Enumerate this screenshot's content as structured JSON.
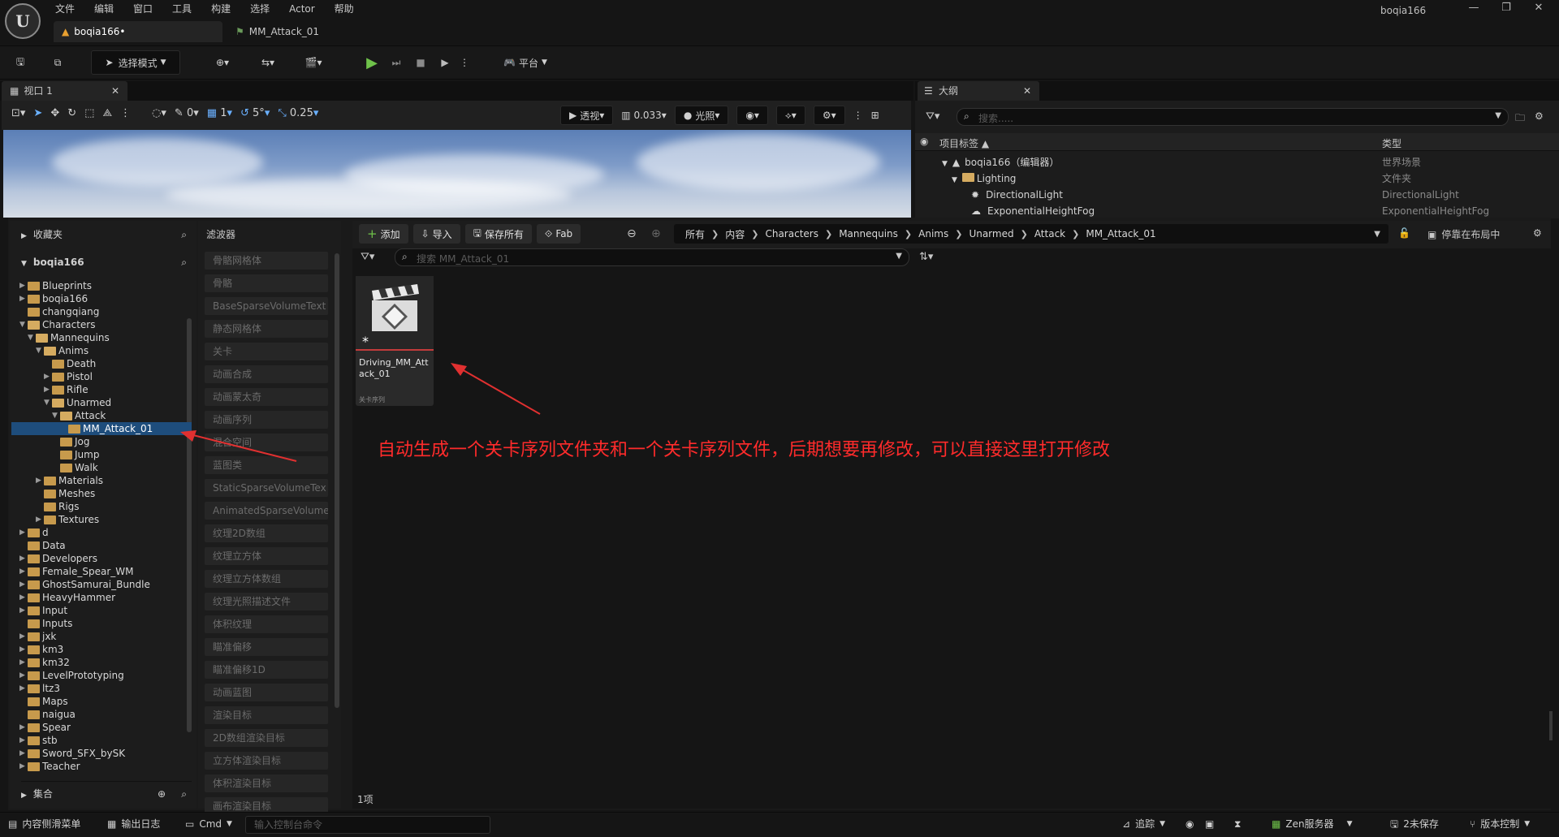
{
  "app": {
    "menu": [
      "文件",
      "编辑",
      "窗口",
      "工具",
      "构建",
      "选择",
      "Actor",
      "帮助"
    ],
    "project_name": "boqia166",
    "window_controls": [
      "—",
      "❐",
      "✕"
    ]
  },
  "doc_tabs": [
    {
      "label": "boqia166•",
      "active": true
    },
    {
      "label": "MM_Attack_01",
      "active": false
    }
  ],
  "toolbar": {
    "mode_label": "选择模式",
    "platform_label": "平台"
  },
  "viewport": {
    "tab_label": "视口 1",
    "view_mode": "透视",
    "lighting": "光照",
    "grid_values": [
      "0",
      "1",
      "5°",
      "0.25"
    ],
    "camera_speed": "0.033"
  },
  "outliner": {
    "tab_label": "大纲",
    "search_placeholder": "搜索.....",
    "col_label": "项目标签 ▲",
    "col_type": "类型",
    "rows": [
      {
        "label": "boqia166（编辑器）",
        "type": "世界场景",
        "indent": 0
      },
      {
        "label": "Lighting",
        "type": "文件夹",
        "indent": 1
      },
      {
        "label": "DirectionalLight",
        "type": "DirectionalLight",
        "indent": 2
      },
      {
        "label": "ExponentialHeightFog",
        "type": "ExponentialHeightFog",
        "indent": 2
      }
    ]
  },
  "content_browser": {
    "favorites_label": "收藏夹",
    "root_label": "boqia166",
    "collections_label": "集合",
    "filters_label": "滤波器",
    "tree": [
      {
        "label": "Blueprints",
        "d": 0,
        "caret": "▶"
      },
      {
        "label": "boqia166",
        "d": 0,
        "caret": "▶"
      },
      {
        "label": "changqiang",
        "d": 0,
        "caret": ""
      },
      {
        "label": "Characters",
        "d": 0,
        "caret": "▼"
      },
      {
        "label": "Mannequins",
        "d": 1,
        "caret": "▼"
      },
      {
        "label": "Anims",
        "d": 2,
        "caret": "▼"
      },
      {
        "label": "Death",
        "d": 3,
        "caret": ""
      },
      {
        "label": "Pistol",
        "d": 3,
        "caret": "▶"
      },
      {
        "label": "Rifle",
        "d": 3,
        "caret": "▶"
      },
      {
        "label": "Unarmed",
        "d": 3,
        "caret": "▼"
      },
      {
        "label": "Attack",
        "d": 4,
        "caret": "▼"
      },
      {
        "label": "MM_Attack_01",
        "d": 5,
        "caret": ""
      },
      {
        "label": "Jog",
        "d": 4,
        "caret": ""
      },
      {
        "label": "Jump",
        "d": 4,
        "caret": ""
      },
      {
        "label": "Walk",
        "d": 4,
        "caret": ""
      },
      {
        "label": "Materials",
        "d": 2,
        "caret": "▶"
      },
      {
        "label": "Meshes",
        "d": 2,
        "caret": ""
      },
      {
        "label": "Rigs",
        "d": 2,
        "caret": ""
      },
      {
        "label": "Textures",
        "d": 2,
        "caret": "▶"
      },
      {
        "label": "d",
        "d": 0,
        "caret": "▶"
      },
      {
        "label": "Data",
        "d": 0,
        "caret": ""
      },
      {
        "label": "Developers",
        "d": 0,
        "caret": "▶"
      },
      {
        "label": "Female_Spear_WM",
        "d": 0,
        "caret": "▶"
      },
      {
        "label": "GhostSamurai_Bundle",
        "d": 0,
        "caret": "▶"
      },
      {
        "label": "HeavyHammer",
        "d": 0,
        "caret": "▶"
      },
      {
        "label": "Input",
        "d": 0,
        "caret": "▶"
      },
      {
        "label": "Inputs",
        "d": 0,
        "caret": ""
      },
      {
        "label": "jxk",
        "d": 0,
        "caret": "▶"
      },
      {
        "label": "km3",
        "d": 0,
        "caret": "▶"
      },
      {
        "label": "km32",
        "d": 0,
        "caret": "▶"
      },
      {
        "label": "LevelPrototyping",
        "d": 0,
        "caret": "▶"
      },
      {
        "label": "ltz3",
        "d": 0,
        "caret": "▶"
      },
      {
        "label": "Maps",
        "d": 0,
        "caret": ""
      },
      {
        "label": "naigua",
        "d": 0,
        "caret": ""
      },
      {
        "label": "Spear",
        "d": 0,
        "caret": "▶"
      },
      {
        "label": "stb",
        "d": 0,
        "caret": "▶"
      },
      {
        "label": "Sword_SFX_bySK",
        "d": 0,
        "caret": "▶"
      },
      {
        "label": "Teacher",
        "d": 0,
        "caret": "▶"
      }
    ],
    "filters": [
      "骨骼网格体",
      "骨骼",
      "BaseSparseVolumeText",
      "静态网格体",
      "关卡",
      "动画合成",
      "动画蒙太奇",
      "动画序列",
      "混合空间",
      "蓝图类",
      "StaticSparseVolumeTex",
      "AnimatedSparseVolume",
      "纹理2D数组",
      "纹理立方体",
      "纹理立方体数组",
      "纹理光照描述文件",
      "体积纹理",
      "瞄准偏移",
      "瞄准偏移1D",
      "动画蓝图",
      "渲染目标",
      "2D数组渲染目标",
      "立方体渲染目标",
      "体积渲染目标",
      "画布渲染目标"
    ],
    "buttons": {
      "add": "添加",
      "import": "导入",
      "save_all": "保存所有",
      "fab": "Fab"
    },
    "breadcrumbs": [
      "所有",
      "内容",
      "Characters",
      "Mannequins",
      "Anims",
      "Unarmed",
      "Attack",
      "MM_Attack_01"
    ],
    "dock_label": "停靠在布局中",
    "search_placeholder": "搜索 MM_Attack_01",
    "asset": {
      "name": "Driving_MM_Attack_01",
      "type": "关卡序列"
    },
    "item_count": "1项"
  },
  "annotation": {
    "text": "自动生成一个关卡序列文件夹和一个关卡序列文件，后期想要再修改，可以直接这里打开修改",
    "color": "#ff2b2b"
  },
  "statusbar": {
    "content_drawer": "内容侧滑菜单",
    "output_log": "输出日志",
    "cmd": "Cmd",
    "cmd_placeholder": "输入控制台命令",
    "trace": "追踪",
    "zen": "Zen服务器",
    "unsaved": "2未保存",
    "source_control": "版本控制"
  }
}
